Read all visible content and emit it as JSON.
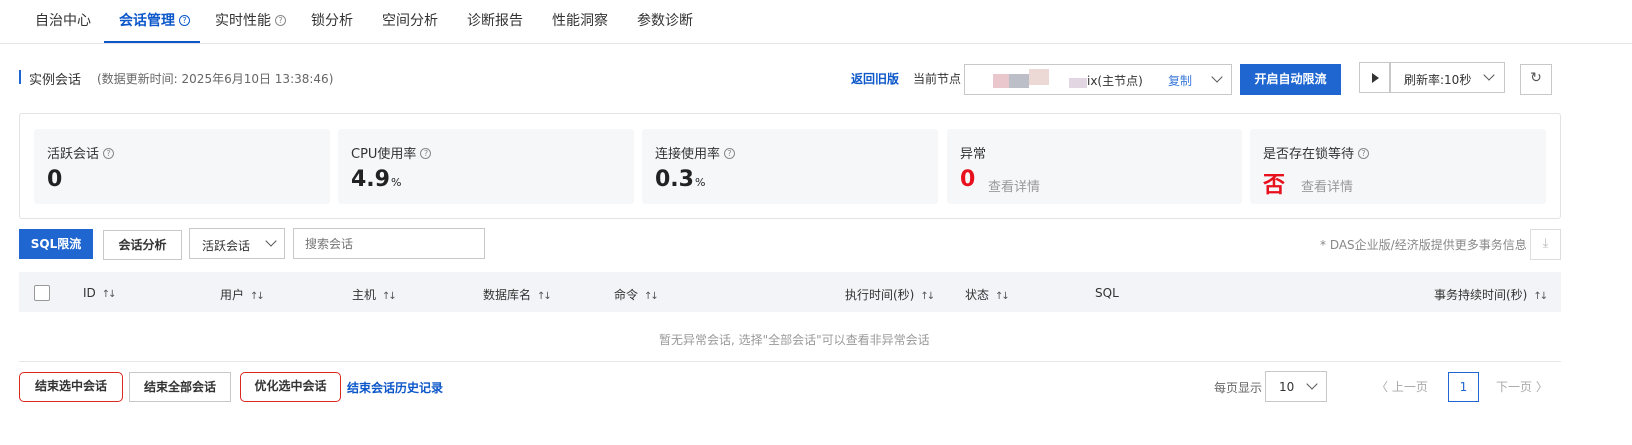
{
  "tabs": [
    {
      "label": "自治中心"
    },
    {
      "label": "会话管理",
      "help": "?"
    },
    {
      "label": "实时性能",
      "help": "?"
    },
    {
      "label": "锁分析"
    },
    {
      "label": "空间分析"
    },
    {
      "label": "诊断报告"
    },
    {
      "label": "性能洞察"
    },
    {
      "label": "参数诊断"
    }
  ],
  "header": {
    "title": "实例会话",
    "update_time": "(数据更新时间:  2025年6月10日 13:38:46)",
    "back_old": "返回旧版",
    "current_node_label": "当前节点",
    "node_suffix": "ix(主节点)",
    "copy": "复制",
    "auto_limit": "开启自动限流",
    "refresh_rate": "刷新率:10秒"
  },
  "cards": [
    {
      "label": "活跃会话",
      "help": "?",
      "value": "0",
      "unit": ""
    },
    {
      "label": "CPU使用率",
      "help": "?",
      "value": "4.9",
      "unit": "%"
    },
    {
      "label": "连接使用率",
      "help": "?",
      "value": "0.3",
      "unit": "%"
    },
    {
      "label": "异常",
      "value": "0",
      "link": "查看详情"
    },
    {
      "label": "是否存在锁等待",
      "help": "?",
      "value": "否",
      "link": "查看详情"
    }
  ],
  "toolbar": {
    "sql_limit": "SQL限流",
    "session_analysis": "会话分析",
    "filter_value": "活跃会话",
    "search_placeholder": "搜索会话",
    "note": "* DAS企业版/经济版提供更多事务信息"
  },
  "table": {
    "columns": [
      "ID",
      "用户",
      "主机",
      "数据库名",
      "命令",
      "执行时间(秒)",
      "状态",
      "SQL",
      "事务持续时间(秒)"
    ],
    "empty": "暂无异常会话, 选择\"全部会话\"可以查看非异常会话"
  },
  "footer": {
    "end_selected": "结束选中会话",
    "end_all": "结束全部会话",
    "optimize_selected": "优化选中会话",
    "history": "结束会话历史记录",
    "page_size_label": "每页显示",
    "page_size": "10",
    "prev": "上一页",
    "page": "1",
    "next": "下一页"
  },
  "colors": {
    "accent": "#1f66d1",
    "link": "#0c57c9",
    "danger": "#e8101c",
    "highlight_border": "#d9281c"
  }
}
